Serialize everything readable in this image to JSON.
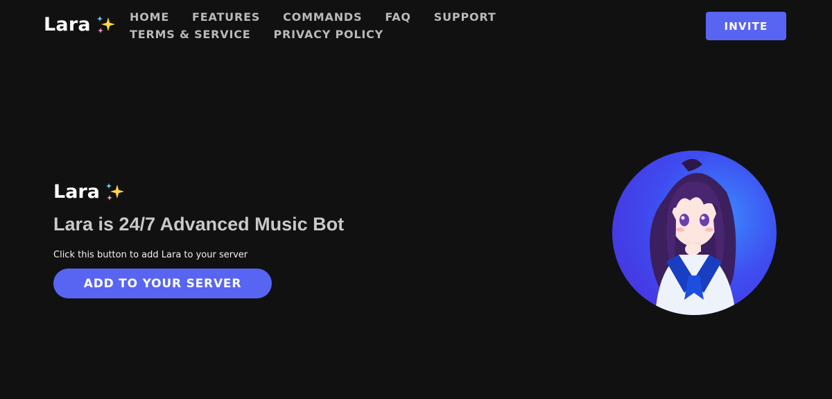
{
  "header": {
    "brand": "Lara",
    "brand_icon": "sparkles-icon",
    "nav": [
      {
        "label": "HOME",
        "name": "nav-home"
      },
      {
        "label": "FEATURES",
        "name": "nav-features"
      },
      {
        "label": "COMMANDS",
        "name": "nav-commands"
      },
      {
        "label": "FAQ",
        "name": "nav-faq"
      },
      {
        "label": "SUPPORT",
        "name": "nav-support"
      },
      {
        "label": "TERMS & SERVICE",
        "name": "nav-terms"
      },
      {
        "label": "PRIVACY POLICY",
        "name": "nav-privacy"
      }
    ],
    "invite_label": "INVITE"
  },
  "hero": {
    "title": "Lara",
    "subtitle": "Lara is 24/7 Advanced Music Bot",
    "description": "Click this button to add Lara to your server",
    "cta_label": "ADD TO YOUR SERVER"
  },
  "colors": {
    "background": "#111112",
    "accent": "#5865f2",
    "nav_text": "#b9b9bd",
    "subtitle_text": "#c9c9cc"
  }
}
